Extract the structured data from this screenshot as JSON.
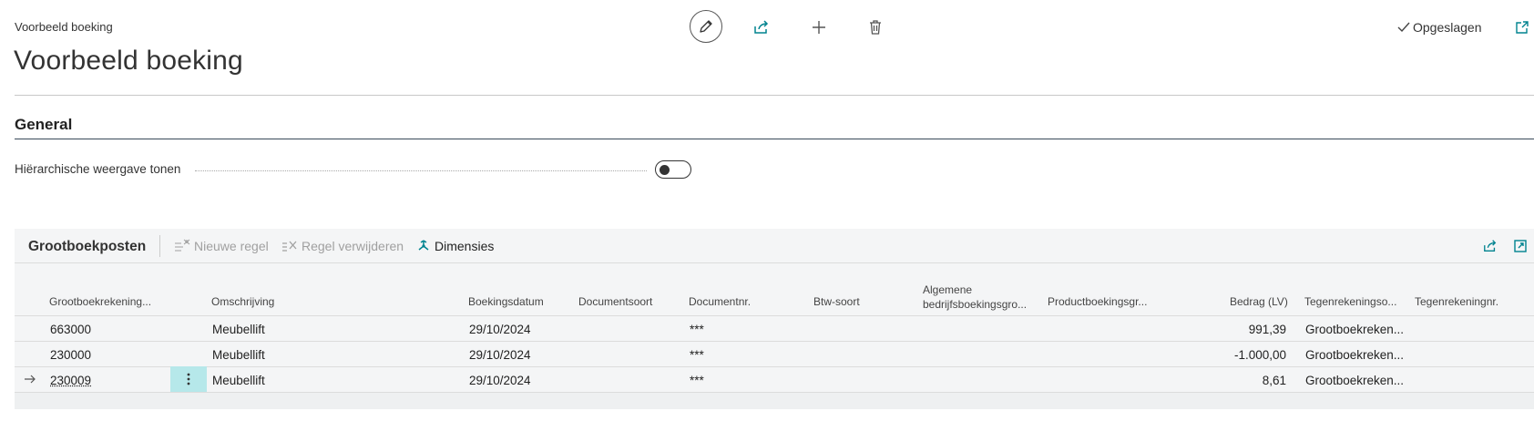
{
  "header": {
    "breadcrumb": "Voorbeeld boeking",
    "title": "Voorbeeld boeking",
    "status": "Opgeslagen",
    "icons": [
      "edit-icon",
      "share-icon",
      "add-icon",
      "delete-icon",
      "open-new-window-icon"
    ]
  },
  "general": {
    "section_title": "General",
    "field_label": "Hiërarchische weergave tonen",
    "toggle_on": false
  },
  "part": {
    "title": "Grootboekposten",
    "actions": [
      {
        "label": "Nieuwe regel",
        "enabled": false,
        "icon": "new-line-icon"
      },
      {
        "label": "Regel verwijderen",
        "enabled": false,
        "icon": "delete-line-icon"
      },
      {
        "label": "Dimensies",
        "enabled": true,
        "icon": "dimensions-icon"
      }
    ],
    "columns": {
      "account": "Grootboekrekening...",
      "description": "Omschrijving",
      "posting_date": "Boekingsdatum",
      "doc_type": "Documentsoort",
      "doc_no": "Documentnr.",
      "vat_type": "Btw-soort",
      "gen_bus_line1": "Algemene",
      "gen_bus_line2": "bedrijfsboekingsgro...",
      "prod_group": "Productboekingsgr...",
      "amount": "Bedrag (LV)",
      "bal_type": "Tegenrekeningso...",
      "bal_no": "Tegenrekeningnr."
    },
    "rows": [
      {
        "account": "663000",
        "description": "Meubellift",
        "posting_date": "29/10/2024",
        "doc_no": "***",
        "amount": "991,39",
        "bal_type": "Grootboekreken..."
      },
      {
        "account": "230000",
        "description": "Meubellift",
        "posting_date": "29/10/2024",
        "doc_no": "***",
        "amount": "-1.000,00",
        "bal_type": "Grootboekreken..."
      },
      {
        "account": "230009",
        "description": "Meubellift",
        "posting_date": "29/10/2024",
        "doc_no": "***",
        "amount": "8,61",
        "bal_type": "Grootboekreken..."
      }
    ],
    "selected_row": 2
  },
  "colors": {
    "accent": "#00838f",
    "selected_cell": "#b6e8ea",
    "panel_bg": "#f4f5f6"
  }
}
